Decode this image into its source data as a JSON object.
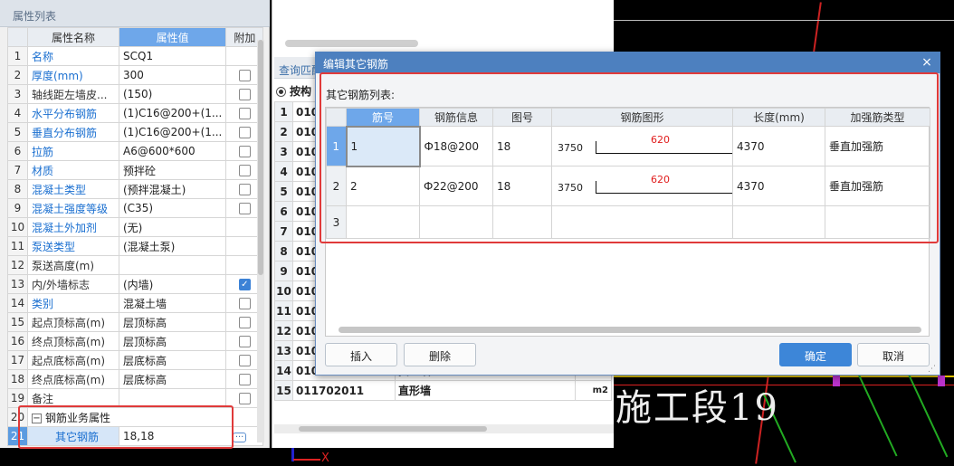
{
  "property_panel": {
    "title": "属性列表",
    "headers": [
      "属性名称",
      "属性值",
      "附加"
    ],
    "rows": [
      {
        "num": "1",
        "name": "名称",
        "value": "SCQ1",
        "link": true,
        "check": null
      },
      {
        "num": "2",
        "name": "厚度(mm)",
        "value": "300",
        "link": true,
        "check": false
      },
      {
        "num": "3",
        "name": "轴线距左墙皮...",
        "value": "(150)",
        "link": false,
        "check": false
      },
      {
        "num": "4",
        "name": "水平分布钢筋",
        "value": "(1)C16@200+(1...",
        "link": true,
        "check": false
      },
      {
        "num": "5",
        "name": "垂直分布钢筋",
        "value": "(1)C16@200+(1...",
        "link": true,
        "check": false
      },
      {
        "num": "6",
        "name": "拉筋",
        "value": "A6@600*600",
        "link": true,
        "check": false
      },
      {
        "num": "7",
        "name": "材质",
        "value": "预拌砼",
        "link": true,
        "check": false
      },
      {
        "num": "8",
        "name": "混凝土类型",
        "value": "(预拌混凝土)",
        "link": true,
        "check": false
      },
      {
        "num": "9",
        "name": "混凝土强度等级",
        "value": "(C35)",
        "link": true,
        "check": false
      },
      {
        "num": "10",
        "name": "混凝土外加剂",
        "value": "(无)",
        "link": true,
        "check": null
      },
      {
        "num": "11",
        "name": "泵送类型",
        "value": "(混凝土泵)",
        "link": true,
        "check": null
      },
      {
        "num": "12",
        "name": "泵送高度(m)",
        "value": "",
        "link": false,
        "check": null
      },
      {
        "num": "13",
        "name": "内/外墙标志",
        "value": "(内墙)",
        "link": false,
        "check": true
      },
      {
        "num": "14",
        "name": "类别",
        "value": "混凝土墙",
        "link": true,
        "check": false
      },
      {
        "num": "15",
        "name": "起点顶标高(m)",
        "value": "层顶标高",
        "link": false,
        "check": false
      },
      {
        "num": "16",
        "name": "终点顶标高(m)",
        "value": "层顶标高",
        "link": false,
        "check": false
      },
      {
        "num": "17",
        "name": "起点底标高(m)",
        "value": "层底标高",
        "link": false,
        "check": false
      },
      {
        "num": "18",
        "name": "终点底标高(m)",
        "value": "层底标高",
        "link": false,
        "check": false
      },
      {
        "num": "19",
        "name": "备注",
        "value": "",
        "link": false,
        "check": false
      }
    ],
    "group_row": {
      "num": "20",
      "name": "钢筋业务属性"
    },
    "sub_row": {
      "num": "21",
      "name": "其它钢筋",
      "value": "18,18",
      "ellipsis": "···"
    }
  },
  "middle_panel": {
    "tab_label": "查询匹配",
    "radio_label": "按构",
    "rows": [
      {
        "n": "1",
        "code": "010",
        "name": "",
        "qty": ""
      },
      {
        "n": "2",
        "code": "010",
        "name": "",
        "qty": ""
      },
      {
        "n": "3",
        "code": "010",
        "name": "",
        "qty": ""
      },
      {
        "n": "4",
        "code": "010",
        "name": "",
        "qty": ""
      },
      {
        "n": "5",
        "code": "010",
        "name": "",
        "qty": ""
      },
      {
        "n": "6",
        "code": "010",
        "name": "",
        "qty": ""
      },
      {
        "n": "7",
        "code": "010",
        "name": "",
        "qty": ""
      },
      {
        "n": "8",
        "code": "010",
        "name": "",
        "qty": ""
      },
      {
        "n": "9",
        "code": "010",
        "name": "",
        "qty": ""
      },
      {
        "n": "10",
        "code": "010",
        "name": "",
        "qty": ""
      },
      {
        "n": "11",
        "code": "010",
        "name": "",
        "qty": ""
      },
      {
        "n": "12",
        "code": "010",
        "name": "",
        "qty": ""
      },
      {
        "n": "13",
        "code": "010",
        "name": "",
        "qty": ""
      },
      {
        "n": "14",
        "code": "010504004",
        "name": "挡土墙",
        "qty": "m3"
      },
      {
        "n": "15",
        "code": "011702011",
        "name": "直形墙",
        "qty": "m2"
      }
    ]
  },
  "dialog": {
    "title": "编辑其它钢筋",
    "close": "×",
    "list_label": "其它钢筋列表:",
    "headers": [
      "筋号",
      "钢筋信息",
      "图号",
      "钢筋图形",
      "长度(mm)",
      "加强筋类型"
    ],
    "rows": [
      {
        "num": "1",
        "id": "1",
        "info": "Ф18@200",
        "fig": "18",
        "shape_left": "3750",
        "shape_mid": "620",
        "length": "4370",
        "type": "垂直加强筋"
      },
      {
        "num": "2",
        "id": "2",
        "info": "Ф22@200",
        "fig": "18",
        "shape_left": "3750",
        "shape_mid": "620",
        "length": "4370",
        "type": "垂直加强筋"
      },
      {
        "num": "3",
        "id": "",
        "info": "",
        "fig": "",
        "shape_left": "",
        "shape_mid": "",
        "length": "",
        "type": ""
      }
    ],
    "buttons": {
      "insert": "插入",
      "delete": "删除",
      "ok": "确定",
      "cancel": "取消"
    }
  },
  "cad": {
    "text": "施工段19",
    "axis_x": "X"
  },
  "colors": {
    "accent": "#3d86d8",
    "highlight_red": "#e03a3a",
    "title_bar": "#4d80bf"
  }
}
